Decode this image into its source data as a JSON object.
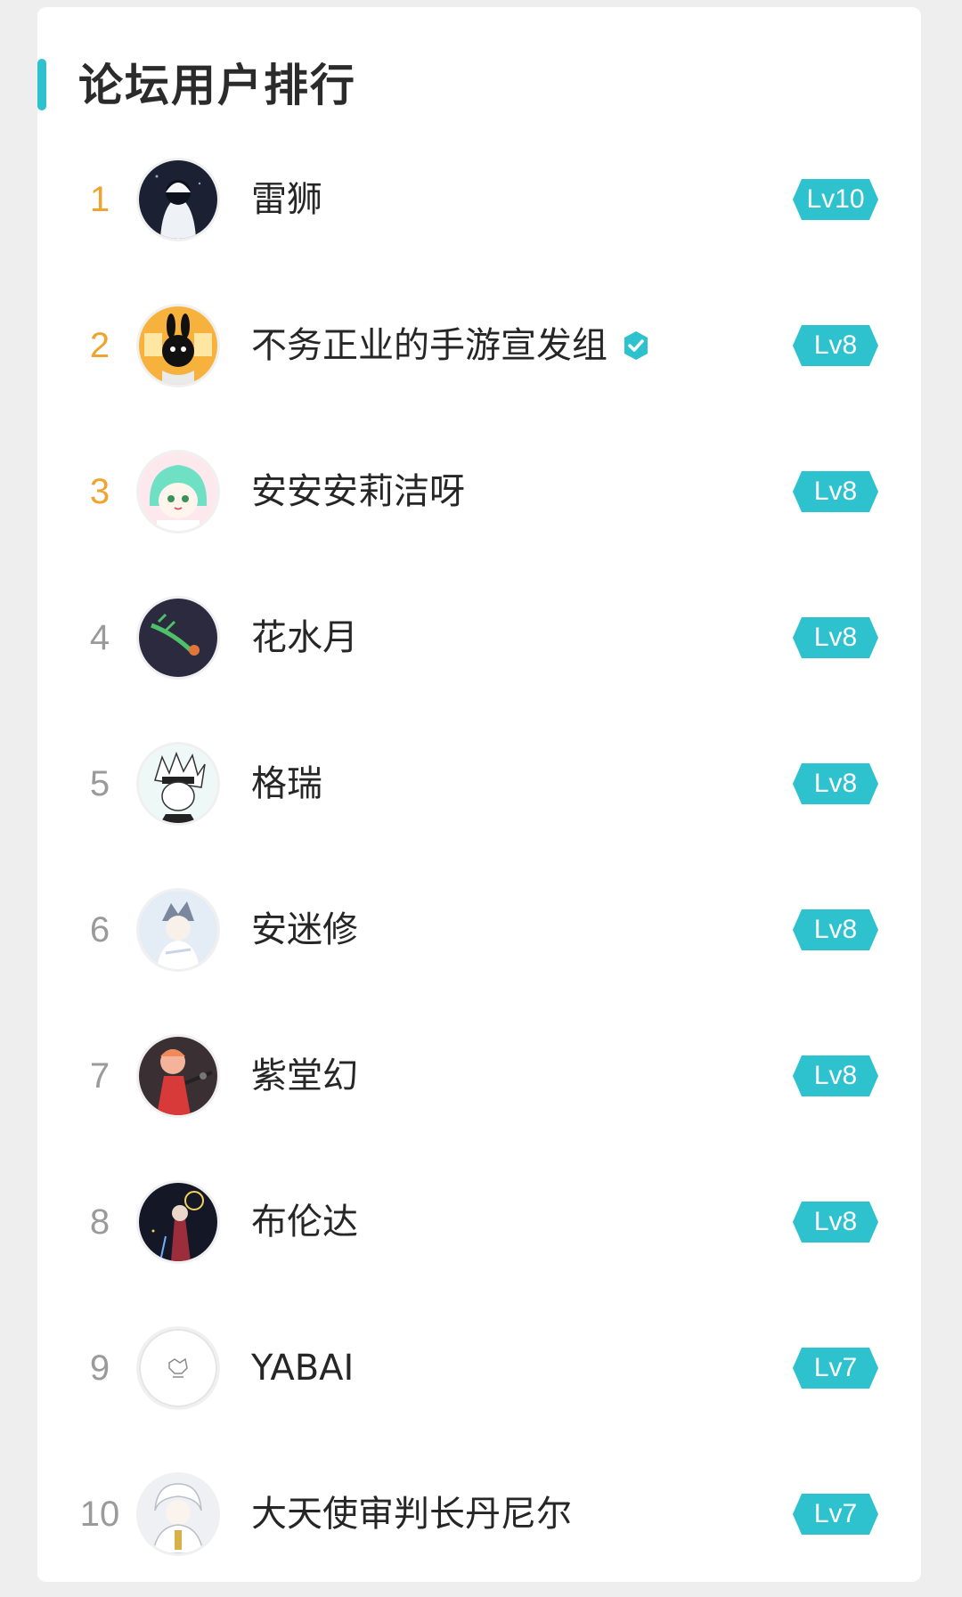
{
  "header": {
    "title": "论坛用户排行"
  },
  "users": [
    {
      "rank": "1",
      "name": "雷狮",
      "level": "Lv10",
      "verified": false,
      "avatar": "avatar-hooded-figure",
      "top": true
    },
    {
      "rank": "2",
      "name": "不务正业的手游宣发组",
      "level": "Lv8",
      "verified": true,
      "avatar": "avatar-black-bunny",
      "top": true
    },
    {
      "rank": "3",
      "name": "安安安莉洁呀",
      "level": "Lv8",
      "verified": false,
      "avatar": "avatar-green-hair-girl",
      "top": true
    },
    {
      "rank": "4",
      "name": "花水月",
      "level": "Lv8",
      "verified": false,
      "avatar": "avatar-dark-plant",
      "top": false
    },
    {
      "rank": "5",
      "name": "格瑞",
      "level": "Lv8",
      "verified": false,
      "avatar": "avatar-white-hair-sketch",
      "top": false
    },
    {
      "rank": "6",
      "name": "安迷修",
      "level": "Lv8",
      "verified": false,
      "avatar": "avatar-light-character",
      "top": false
    },
    {
      "rank": "7",
      "name": "紫堂幻",
      "level": "Lv8",
      "verified": false,
      "avatar": "avatar-red-dress-girl",
      "top": false
    },
    {
      "rank": "8",
      "name": "布伦达",
      "level": "Lv8",
      "verified": false,
      "avatar": "avatar-night-figure",
      "top": false
    },
    {
      "rank": "9",
      "name": "YABAI",
      "level": "Lv7",
      "verified": false,
      "avatar": "avatar-white-logo",
      "top": false
    },
    {
      "rank": "10",
      "name": "大天使审判长丹尼尔",
      "level": "Lv7",
      "verified": false,
      "avatar": "avatar-white-angel",
      "top": false
    }
  ],
  "colors": {
    "accent": "#2ec2cf",
    "rank_top": "#f0a32f",
    "rank_other": "#9a9a9a"
  }
}
